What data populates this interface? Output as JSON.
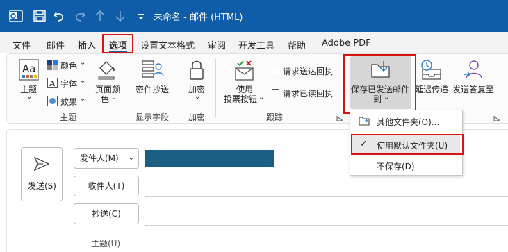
{
  "titlebar": {
    "title": "未命名 - 邮件 (HTML)",
    "icons": [
      "outlook-logo-icon",
      "save-icon",
      "undo-icon",
      "redo-icon",
      "up-arrow-icon",
      "down-arrow-icon",
      "customize-toolbar-icon"
    ]
  },
  "menu": {
    "tabs": [
      "文件",
      "邮件",
      "插入",
      "选项",
      "设置文本格式",
      "审阅",
      "开发工具",
      "帮助",
      "Adobe PDF"
    ],
    "active": "选项"
  },
  "ribbon": {
    "theme": {
      "label": "主题",
      "colors": "颜色",
      "fonts": "字体",
      "effects": "效果",
      "page_color_1": "页面颜",
      "page_color_2": "色",
      "group": "主题"
    },
    "show_fields": {
      "cc": "密件抄送",
      "group": "显示字段"
    },
    "encrypt": {
      "label": "加密",
      "group": "加密"
    },
    "tracking": {
      "voting_1": "使用",
      "voting_2": "投票按钮",
      "delivery_receipt": "请求送达回执",
      "read_receipt": "请求已读回执",
      "group": "跟踪"
    },
    "save_sent": {
      "label_1": "保存已发送邮件",
      "label_2": "到"
    },
    "delay": {
      "label": "延迟传递"
    },
    "reply_to": {
      "label": "发送答复至"
    }
  },
  "dropdown": {
    "items": [
      {
        "label": "其他文件夹(O)...",
        "checked": false
      },
      {
        "label": "使用默认文件夹(U)",
        "checked": true
      },
      {
        "label": "不保存(D)",
        "checked": false
      }
    ]
  },
  "compose": {
    "send_label": "发送(S)",
    "from_label": "发件人(M)",
    "to_label": "收件人(T)",
    "cc_label": "抄送(C)",
    "subject_label": "主题(U)"
  },
  "colors": {
    "titlebar": "#0f5ca8",
    "highlight": "#d81313",
    "from_field": "#1b5f82"
  }
}
